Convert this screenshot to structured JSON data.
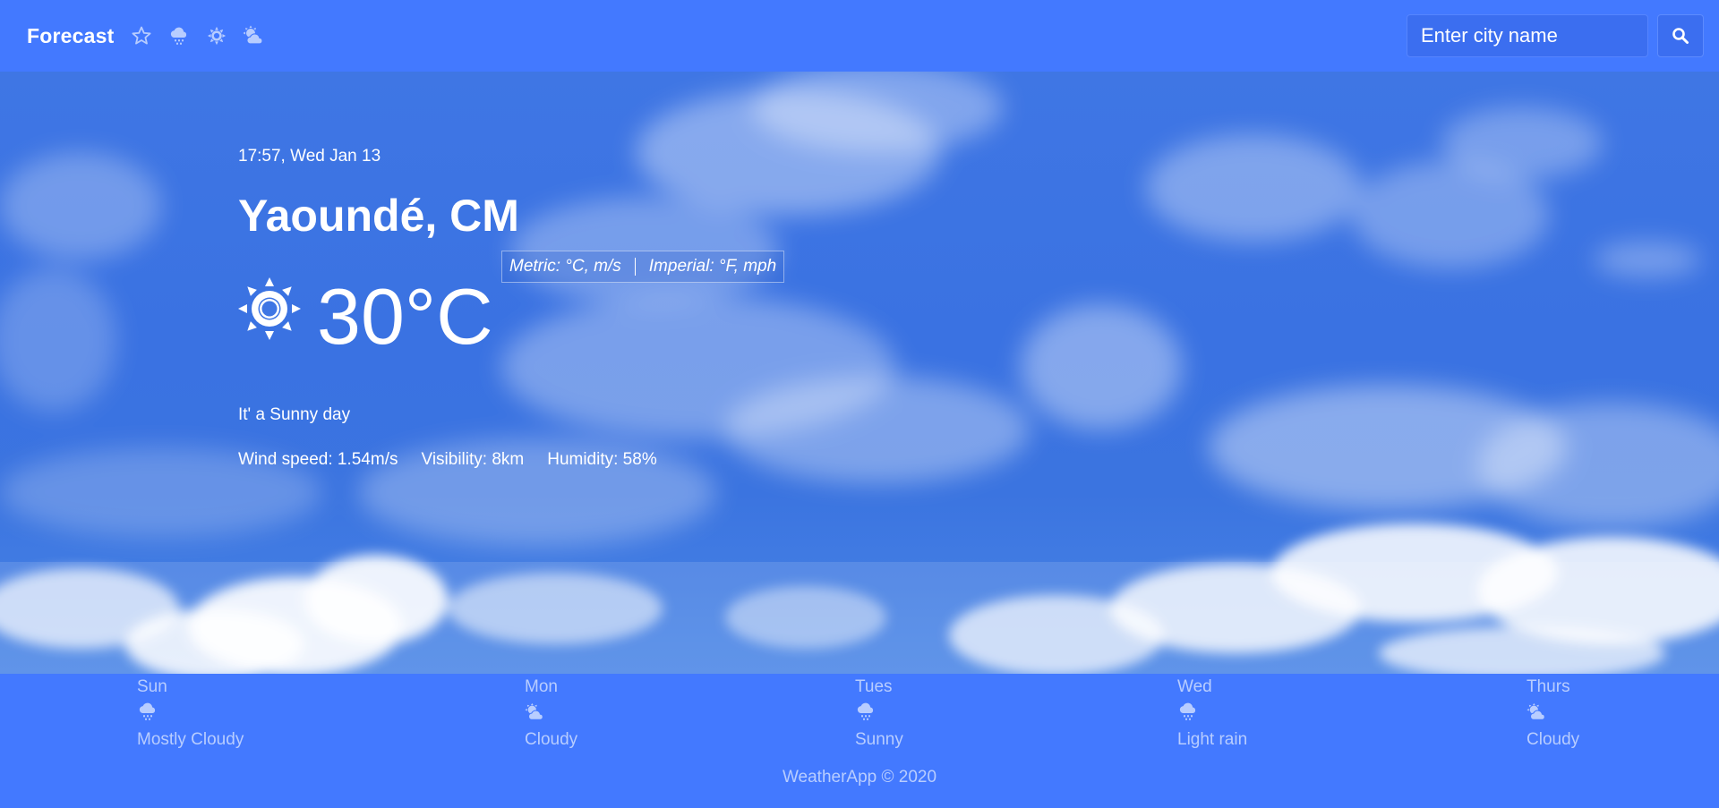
{
  "navbar": {
    "brand": "Forecast",
    "icons": [
      "star-icon",
      "rain-cloud-icon",
      "sun-icon",
      "partly-cloudy-icon"
    ]
  },
  "search": {
    "placeholder": "Enter city name"
  },
  "current": {
    "datetime": "17:57, Wed Jan 13",
    "city": "Yaoundé, CM",
    "units": {
      "metric": "Metric: °C, m/s",
      "imperial": "Imperial: °F, mph"
    },
    "icon": "sun-icon",
    "temperature": "30°C",
    "description": "It' a Sunny day",
    "stats": {
      "wind": "Wind speed: 1.54m/s",
      "visibility": "Visibility: 8km",
      "humidity": "Humidity: 58%"
    }
  },
  "forecast": [
    {
      "day": "Sun",
      "icon": "rain-cloud-icon",
      "condition": "Mostly Cloudy"
    },
    {
      "day": "Mon",
      "icon": "partly-cloudy-icon",
      "condition": "Cloudy"
    },
    {
      "day": "Tues",
      "icon": "rain-cloud-icon",
      "condition": "Sunny"
    },
    {
      "day": "Wed",
      "icon": "rain-cloud-icon",
      "condition": "Light rain"
    },
    {
      "day": "Thurs",
      "icon": "partly-cloudy-icon",
      "condition": "Cloudy"
    }
  ],
  "footer": "WeatherApp © 2020",
  "colors": {
    "primary": "#4379ff",
    "muted_text": "#b8cdff",
    "text": "#ffffff"
  }
}
